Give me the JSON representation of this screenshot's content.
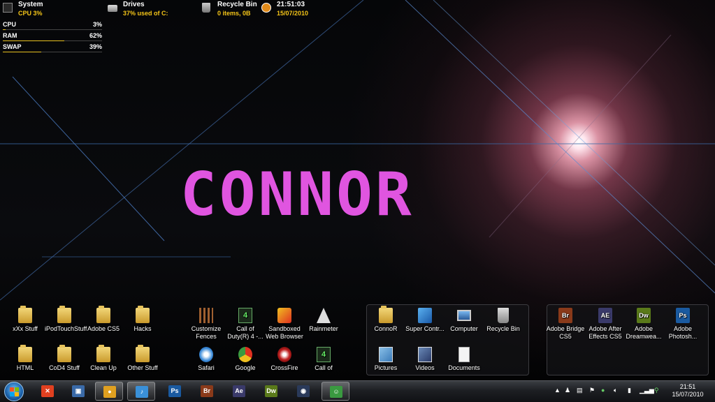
{
  "gadgets": {
    "system": {
      "title": "System",
      "sub": "CPU 3%"
    },
    "drives": {
      "title": "Drives",
      "sub": "37% used of C:"
    },
    "recycle": {
      "title": "Recycle Bin",
      "sub": "0 items, 0B"
    },
    "clock": {
      "time": "21:51:03",
      "date": "15/07/2010"
    }
  },
  "meters": [
    {
      "label": "CPU",
      "value": "3%",
      "percent": 3
    },
    {
      "label": "RAM",
      "value": "62%",
      "percent": 62
    },
    {
      "label": "SWAP",
      "value": "39%",
      "percent": 39
    }
  ],
  "wallpaper_text": "CONNOR",
  "desktop": {
    "group1": [
      "xXx Stuff",
      "iPodTouchStuff",
      "Adobe CS5",
      "Hacks",
      "HTML",
      "CoD4 Stuff",
      "Clean Up",
      "Other Stuff"
    ],
    "group2": [
      "Customize Fences",
      "Call of Duty(R) 4 -...",
      "Sandboxed Web Browser",
      "Rainmeter",
      "Safari",
      "Google",
      "CrossFire",
      "Call of"
    ],
    "fence1": [
      "ConnoR",
      "Super Contr...",
      "Computer",
      "Recycle Bin",
      "Pictures",
      "Videos",
      "Documents"
    ],
    "fence2": [
      {
        "label": "Adobe Bridge CS5",
        "abbr": "Br",
        "color": "#8a3a1a"
      },
      {
        "label": "Adobe After Effects CS5",
        "abbr": "AE",
        "color": "#3a3a6a"
      },
      {
        "label": "Adobe Dreamwea...",
        "abbr": "Dw",
        "color": "#5a7a1a"
      },
      {
        "label": "Adobe Photosh...",
        "abbr": "Ps",
        "color": "#1a5aa0"
      }
    ]
  },
  "taskbar": {
    "apps": [
      {
        "name": "x-icon",
        "abbr": "✕",
        "color": "#e04020"
      },
      {
        "name": "window-icon",
        "abbr": "▣",
        "color": "#3a6aa8"
      },
      {
        "name": "chrome-icon",
        "abbr": "●",
        "color": "#e0a020"
      },
      {
        "name": "itunes-icon",
        "abbr": "♪",
        "color": "#3a90d8"
      },
      {
        "name": "photoshop-icon",
        "abbr": "Ps",
        "color": "#1a5aa0"
      },
      {
        "name": "bridge-icon",
        "abbr": "Br",
        "color": "#8a3a1a"
      },
      {
        "name": "after-effects-icon",
        "abbr": "Ae",
        "color": "#3a3a6a"
      },
      {
        "name": "dreamweaver-icon",
        "abbr": "Dw",
        "color": "#5a7a1a"
      },
      {
        "name": "gamepad-icon",
        "abbr": "◉",
        "color": "#2a3a5a"
      },
      {
        "name": "messenger-icon",
        "abbr": "☺",
        "color": "#3a9a40"
      }
    ],
    "tray_time": "21:51",
    "tray_date": "15/07/2010"
  }
}
